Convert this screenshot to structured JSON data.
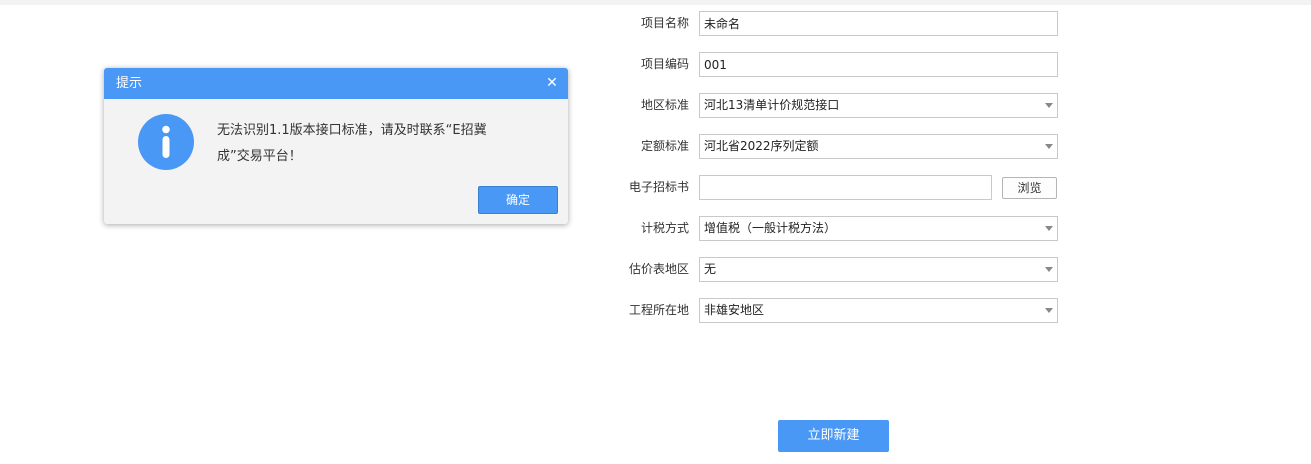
{
  "form": {
    "project_name": {
      "label": "项目名称",
      "value": "未命名"
    },
    "project_code": {
      "label": "项目编码",
      "value": "001"
    },
    "region_standard": {
      "label": "地区标准",
      "value": "河北13清单计价规范接口"
    },
    "quota_standard": {
      "label": "定额标准",
      "value": "河北省2022序列定额"
    },
    "tender_file": {
      "label": "电子招标书",
      "value": "",
      "browse_label": "浏览"
    },
    "tax_method": {
      "label": "计税方式",
      "value": "增值税（一般计税方法）"
    },
    "price_table_region": {
      "label": "估价表地区",
      "value": "无"
    },
    "project_location": {
      "label": "工程所在地",
      "value": "非雄安地区"
    },
    "create_label": "立即新建"
  },
  "dialog": {
    "title": "提示",
    "close_symbol": "✕",
    "message_line1": "无法识别1.1版本接口标准，请及时联系“E招冀",
    "message_line2": "成”交易平台！",
    "ok_label": "确定",
    "icon": "info-icon"
  },
  "colors": {
    "accent": "#4a98f6",
    "dialog_bg": "#f3f3f3",
    "field_border": "#c9c9c9"
  }
}
